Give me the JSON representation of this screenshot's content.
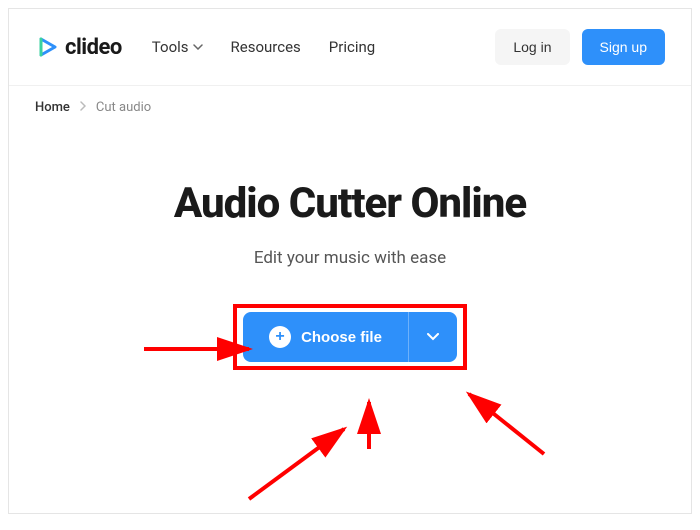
{
  "header": {
    "brand": "clideo",
    "nav": {
      "tools": "Tools",
      "resources": "Resources",
      "pricing": "Pricing"
    },
    "auth": {
      "login": "Log in",
      "signup": "Sign up"
    }
  },
  "breadcrumb": {
    "home": "Home",
    "current": "Cut audio"
  },
  "main": {
    "title": "Audio Cutter Online",
    "subtitle": "Edit your music with ease",
    "choose_file": "Choose file"
  },
  "colors": {
    "primary": "#2e90fa",
    "highlight": "#ff0000"
  }
}
